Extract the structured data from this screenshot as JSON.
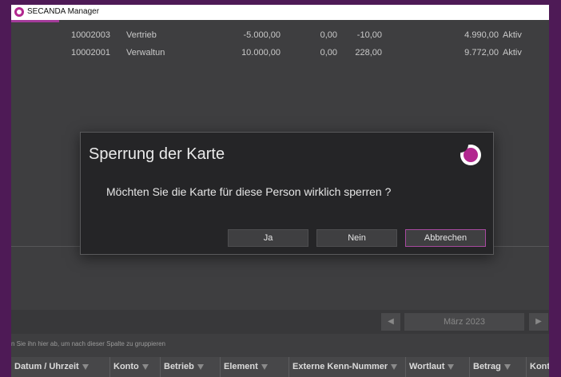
{
  "window": {
    "title": "SECANDA Manager"
  },
  "table_rows": [
    {
      "id": "10002003",
      "dept": "Vertrieb",
      "v1": "-5.000,00",
      "v2": "0,00",
      "v3": "-10,00",
      "v4": "4.990,00",
      "status": "Aktiv"
    },
    {
      "id": "10002001",
      "dept": "Verwaltun",
      "v1": "10.000,00",
      "v2": "0,00",
      "v3": "228,00",
      "v4": "9.772,00",
      "status": "Aktiv"
    }
  ],
  "dialog": {
    "title": "Sperrung der Karte",
    "message": "Möchten Sie die Karte für diese Person wirklich sperren ?",
    "buttons": {
      "yes": "Ja",
      "no": "Nein",
      "cancel": "Abbrechen"
    },
    "accent": "#b2278f"
  },
  "navigator": {
    "month": "März 2023",
    "prev_icon": "chevron-left-icon",
    "next_icon": "chevron-right-icon"
  },
  "group_hint": "n Sie ihn hier ab, um nach dieser Spalte zu gruppieren",
  "grid_columns": [
    "Datum / Uhrzeit",
    "Konto",
    "Betrieb",
    "Element",
    "Externe Kenn-Nummer",
    "Wortlaut",
    "Betrag",
    "Kont"
  ],
  "colors": {
    "background": "#4e1a56",
    "accent": "#b2278f",
    "app_bg": "#3e3e40"
  }
}
